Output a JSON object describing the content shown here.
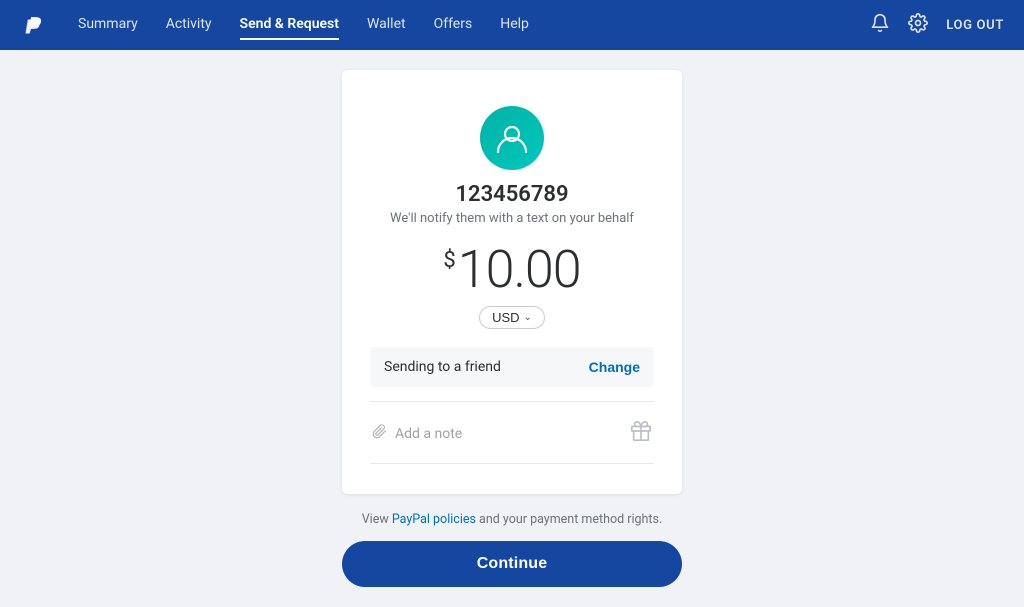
{
  "header": {
    "logo_alt": "PayPal",
    "nav": [
      {
        "label": "Summary",
        "active": false
      },
      {
        "label": "Activity",
        "active": false
      },
      {
        "label": "Send & Request",
        "active": true
      },
      {
        "label": "Wallet",
        "active": false
      },
      {
        "label": "Offers",
        "active": false
      },
      {
        "label": "Help",
        "active": false
      }
    ],
    "logout_label": "LOG OUT"
  },
  "recipient": {
    "name": "123456789",
    "notify_text": "We'll notify them with a text on your behalf"
  },
  "amount": {
    "currency_symbol": "$",
    "value": "10.00",
    "currency": "USD"
  },
  "sending": {
    "label": "Sending to a friend",
    "change_label": "Change"
  },
  "note": {
    "placeholder": "Add a note",
    "attachment_icon": "📎",
    "gift_icon": "🎁"
  },
  "footer": {
    "policy_text_before": "View ",
    "policy_link": "PayPal policies",
    "policy_text_after": " and your payment method rights.",
    "continue_label": "Continue"
  }
}
